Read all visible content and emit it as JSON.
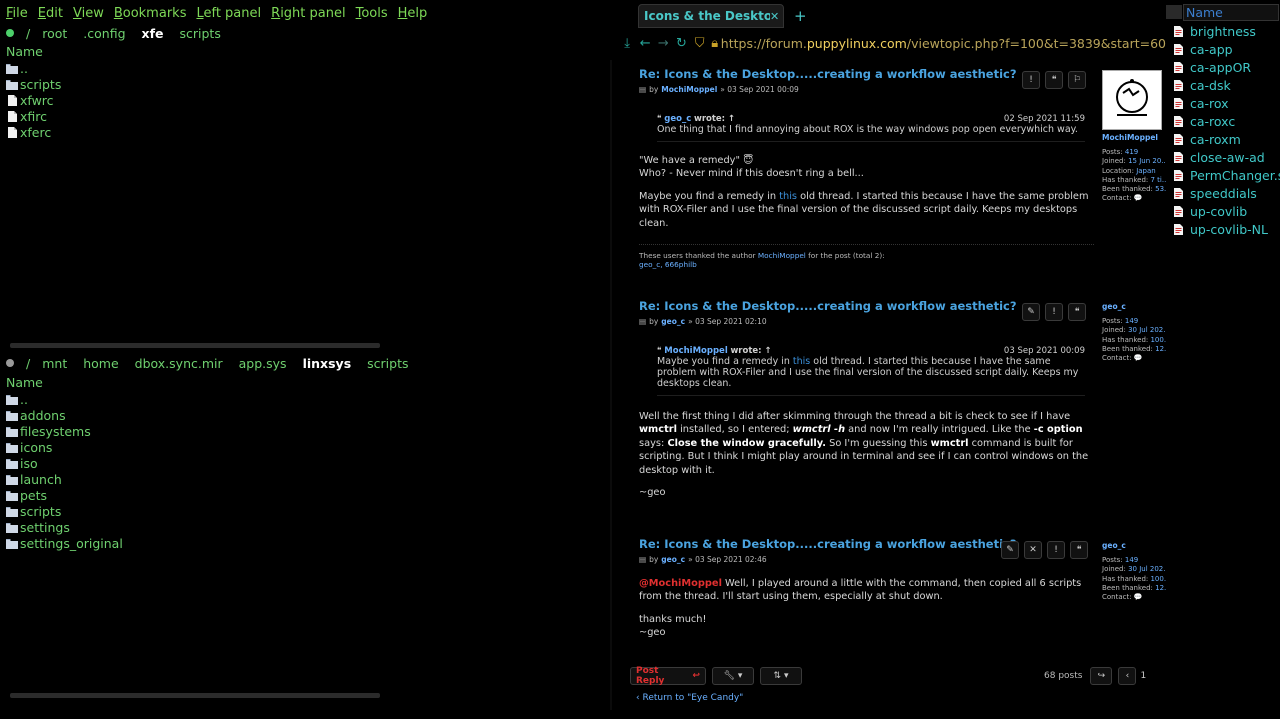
{
  "xfe": {
    "menu": [
      {
        "u": "F",
        "rest": "ile"
      },
      {
        "u": "E",
        "rest": "dit"
      },
      {
        "u": "V",
        "rest": "iew"
      },
      {
        "u": "B",
        "rest": "ookmarks"
      },
      {
        "u": "L",
        "rest": "eft panel"
      },
      {
        "u": "R",
        "rest": "ight panel"
      },
      {
        "u": "T",
        "rest": "ools"
      },
      {
        "u": "H",
        "rest": "elp"
      }
    ],
    "top_panel": {
      "status_color": "#4cd06a",
      "path": [
        "/",
        "root",
        ".config",
        "xfe",
        "scripts"
      ],
      "active_index": 3,
      "column": "Name",
      "items": [
        {
          "name": "..",
          "type": "folder"
        },
        {
          "name": "scripts",
          "type": "folder"
        },
        {
          "name": "xfwrc",
          "type": "file"
        },
        {
          "name": "xfirc",
          "type": "file"
        },
        {
          "name": "xferc",
          "type": "file"
        }
      ]
    },
    "bottom_panel": {
      "status_color": "#9a9a9a",
      "path": [
        "/",
        "mnt",
        "home",
        "dbox.sync.mir",
        "app.sys",
        "linxsys",
        "scripts"
      ],
      "active_index": 5,
      "column": "Name",
      "items": [
        {
          "name": "..",
          "type": "folder"
        },
        {
          "name": "addons",
          "type": "folder"
        },
        {
          "name": "filesystems",
          "type": "folder"
        },
        {
          "name": "icons",
          "type": "folder"
        },
        {
          "name": "iso",
          "type": "folder"
        },
        {
          "name": "launch",
          "type": "folder"
        },
        {
          "name": "pets",
          "type": "folder"
        },
        {
          "name": "scripts",
          "type": "folder"
        },
        {
          "name": "settings",
          "type": "folder"
        },
        {
          "name": "settings_original",
          "type": "folder"
        }
      ]
    }
  },
  "browser": {
    "tab_title": "Icons & the Desktop.....",
    "url_prefix": "https://forum.",
    "url_domain": "puppylinux.com",
    "url_path": "/viewtopic.php?f=100&t=3839&start=60",
    "posts": [
      {
        "title": "Re: Icons & the Desktop.....creating a workflow aesthetic?",
        "by": "by",
        "author": "MochiMoppel",
        "date": "» 03 Sep 2021 00:09",
        "quote_author": "geo_c",
        "quote_wrote": "wrote: ↑",
        "quote_date": "02 Sep 2021 11:59",
        "quote_text": "One thing that I find annoying about ROX is the way windows pop open everywhich way.",
        "p1": "\"We have a remedy\" 😇",
        "p2": "Who? - Never mind if this doesn't ring a bell...",
        "p3a": "Maybe you find a remedy in ",
        "p3link": "this",
        "p3b": " old thread. I started this because I have the same problem with ROX-Filer and I use the final version of the discussed script daily. Keeps my desktops clean.",
        "thanks_a": "These users thanked the author ",
        "thanks_author": "MochiMoppel",
        "thanks_b": " for the post (total 2):",
        "thanks_users": "geo_c, 666philb",
        "profile": {
          "name": "MochiMoppel",
          "rows": [
            {
              "k": "Posts:",
              "v": "419"
            },
            {
              "k": "Joined:",
              "v": "15 Jun 20..."
            },
            {
              "k": "Location:",
              "v": "Japan"
            },
            {
              "k": "Has thanked:",
              "v": "7 ti..."
            },
            {
              "k": "Been thanked:",
              "v": "53..."
            },
            {
              "k": "Contact:",
              "v": "💬"
            }
          ]
        }
      },
      {
        "title": "Re: Icons & the Desktop.....creating a workflow aesthetic?",
        "by": "by",
        "author": "geo_c",
        "date": "» 03 Sep 2021 02:10",
        "quote_author": "MochiMoppel",
        "quote_wrote": "wrote: ↑",
        "quote_date": "03 Sep 2021 00:09",
        "quote_text_a": "Maybe you find a remedy in ",
        "quote_link": "this",
        "quote_text_b": " old thread. I started this because I have the same problem with ROX-Filer and I use the final version of the discussed script daily. Keeps my desktops clean.",
        "b1": "Well the first thing I did after skimming through the thread a bit is check to see if I have ",
        "b2": "wmctrl",
        "b3": " installed, so I entered; ",
        "b4": "wmctrl -h",
        "b5": " and now I'm really intrigued. Like the ",
        "b6": "-c option",
        "b7": " says: ",
        "b8": "Close the window gracefully.",
        "b9": " So I'm guessing this ",
        "b10": "wmctrl",
        "b11": " command is built for scripting. But I think I might play around in terminal and see if I can control windows on the desktop with it.",
        "sig": "~geo",
        "profile": {
          "name": "geo_c",
          "rows": [
            {
              "k": "Posts:",
              "v": "149"
            },
            {
              "k": "Joined:",
              "v": "30 Jul 202..."
            },
            {
              "k": "Has thanked:",
              "v": "100..."
            },
            {
              "k": "Been thanked:",
              "v": "12..."
            },
            {
              "k": "Contact:",
              "v": "💬"
            }
          ]
        }
      },
      {
        "title": "Re: Icons & the Desktop.....creating a workflow aesthetic?",
        "by": "by",
        "author": "geo_c",
        "date": "» 03 Sep 2021 02:46",
        "mention": "@MochiMoppel",
        "t1": " Well, I played around a little with the command, then copied all 6 scripts from the thread. I'll start using them, especially at shut down.",
        "t2": "thanks much!",
        "t3": "~geo",
        "profile": {
          "name": "geo_c",
          "rows": [
            {
              "k": "Posts:",
              "v": "149"
            },
            {
              "k": "Joined:",
              "v": "30 Jul 202..."
            },
            {
              "k": "Has thanked:",
              "v": "100..."
            },
            {
              "k": "Been thanked:",
              "v": "12..."
            },
            {
              "k": "Contact:",
              "v": "💬"
            }
          ]
        }
      }
    ],
    "post_reply": "Post Reply",
    "posts_count": "68 posts",
    "page_number": "1",
    "return_link": "Return to \"Eye Candy\""
  },
  "right_panel": {
    "column": "Name",
    "items": [
      "brightness",
      "ca-app",
      "ca-appOR",
      "ca-dsk",
      "ca-rox",
      "ca-roxc",
      "ca-roxm",
      "close-aw-ad",
      "PermChanger.sh",
      "speeddials",
      "up-covlib",
      "up-covlib-NL"
    ]
  },
  "colors": {
    "accent_green": "#6fd06f",
    "accent_cyan": "#40c8c8",
    "link_blue": "#4aa3df"
  }
}
